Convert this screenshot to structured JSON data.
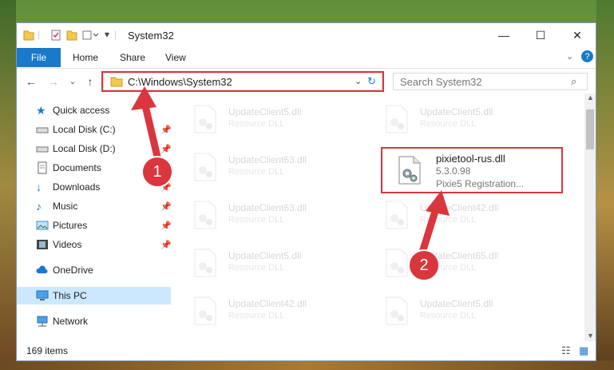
{
  "window": {
    "title": "System32"
  },
  "ribbon": {
    "tabs": [
      "File",
      "Home",
      "Share",
      "View"
    ]
  },
  "address": {
    "path": "C:\\Windows\\System32"
  },
  "search": {
    "placeholder": "Search System32"
  },
  "sidebar": {
    "items": [
      {
        "label": "Quick access",
        "icon": "star-icon"
      },
      {
        "label": "Local Disk (C:)",
        "icon": "drive-icon",
        "pinned": true
      },
      {
        "label": "Local Disk (D:)",
        "icon": "drive-icon",
        "pinned": true
      },
      {
        "label": "Documents",
        "icon": "documents-icon",
        "pinned": true
      },
      {
        "label": "Downloads",
        "icon": "downloads-icon",
        "pinned": true
      },
      {
        "label": "Music",
        "icon": "music-icon",
        "pinned": true
      },
      {
        "label": "Pictures",
        "icon": "pictures-icon",
        "pinned": true
      },
      {
        "label": "Videos",
        "icon": "videos-icon",
        "pinned": true
      },
      {
        "label": "OneDrive",
        "icon": "cloud-icon"
      },
      {
        "label": "This PC",
        "icon": "pc-icon",
        "selected": true
      },
      {
        "label": "Network",
        "icon": "network-icon"
      }
    ]
  },
  "files": [
    {
      "name": "UpdateClient5.dll",
      "type": "Resource DLL"
    },
    {
      "name": "UpdateClient5.dll",
      "type": "Resource DLL"
    },
    {
      "name": "UpdateClient63.dll",
      "type": "Resource DLL"
    },
    {
      "name": "pixietool-rus.dll",
      "version": "5.3.0.98",
      "desc": "Pixie5 Registration..."
    },
    {
      "name": "UpdateClient63.dll",
      "type": "Resource DLL"
    },
    {
      "name": "UpdateClient42.dll",
      "type": "Resource DLL"
    },
    {
      "name": "UpdateClient5.dll",
      "type": "Resource DLL"
    },
    {
      "name": "UpdateClient65.dll",
      "type": "Resource DLL"
    },
    {
      "name": "UpdateClient42.dll",
      "type": "Resource DLL"
    },
    {
      "name": "UpdateClient5.dll",
      "type": "Resource DLL"
    }
  ],
  "status": {
    "count": "169 items"
  },
  "annotations": {
    "step1": "1",
    "step2": "2"
  },
  "colors": {
    "accent": "#1979ca",
    "highlight": "#d9363e",
    "selected": "#cce8ff"
  }
}
